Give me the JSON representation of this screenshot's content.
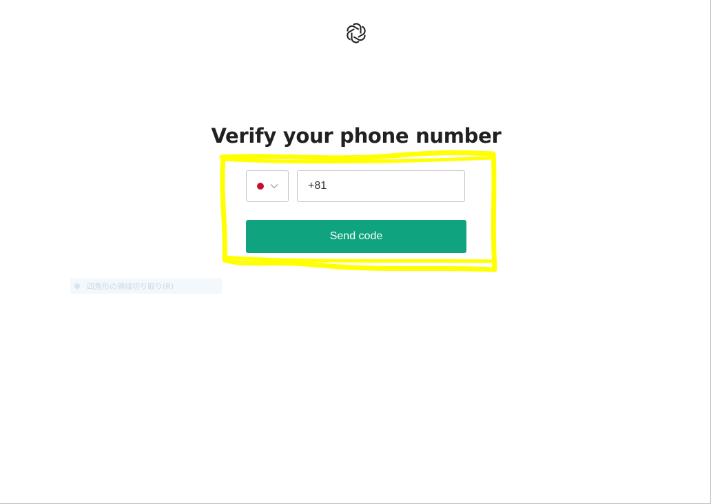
{
  "header": {
    "logo_icon": "openai-logo-icon"
  },
  "main": {
    "title": "Verify your phone number",
    "country_selector": {
      "selected_country": "Japan",
      "flag_color": "#c8102e",
      "icon": "chevron-down-icon"
    },
    "phone_input": {
      "value": "+81",
      "placeholder": ""
    },
    "send_button": {
      "label": "Send code",
      "color": "#10a37f"
    },
    "annotation": {
      "type": "hand-drawn highlight box",
      "color": "#ffff00"
    }
  },
  "overlay": {
    "faint_tooltip_text": "四角形の領域切り取り(R)"
  }
}
